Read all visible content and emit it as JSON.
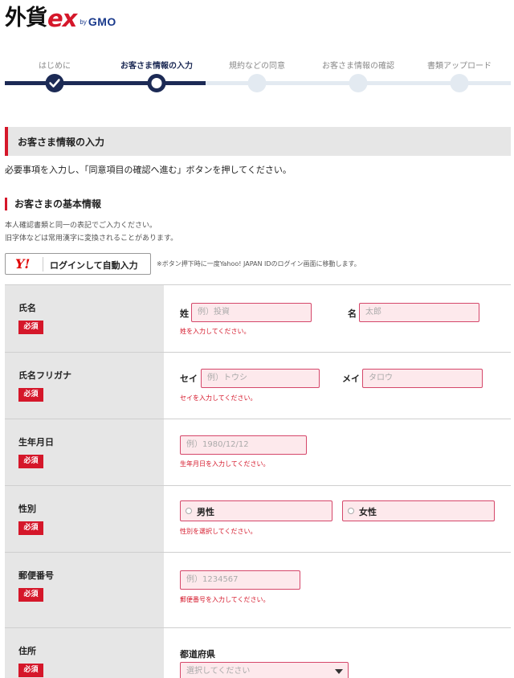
{
  "brand": {
    "main": "外貨",
    "ex": "ex",
    "by": "by",
    "gmo": "GMO"
  },
  "steps": [
    {
      "label": "はじめに",
      "state": "done"
    },
    {
      "label": "お客さま情報の入力",
      "state": "current"
    },
    {
      "label": "規約などの同意",
      "state": "todo"
    },
    {
      "label": "お客さま情報の確認",
      "state": "todo"
    },
    {
      "label": "書類アップロード",
      "state": "todo"
    }
  ],
  "section": {
    "title": "お客さま情報の入力",
    "intro": "必要事項を入力し、「同意項目の確認へ進む」ボタンを押してください。"
  },
  "basic": {
    "title": "お客さまの基本情報",
    "note1": "本人確認書類と同一の表記でご入力ください。",
    "note2": "旧字体などは常用漢字に変換されることがあります。"
  },
  "yahoo": {
    "icon": "Y!",
    "label": "ログインして自動入力",
    "note": "※ボタン押下時に一度Yahoo! JAPAN IDのログイン画面に移動します。"
  },
  "required_label": "必須",
  "form": {
    "name": {
      "label": "氏名",
      "last_prefix": "姓",
      "last_placeholder": "例）投資",
      "first_prefix": "名",
      "first_placeholder": "太郎",
      "error": "姓を入力してください。"
    },
    "kana": {
      "label": "氏名フリガナ",
      "last_prefix": "セイ",
      "last_placeholder": "例）トウシ",
      "first_prefix": "メイ",
      "first_placeholder": "タロウ",
      "error": "セイを入力してください。"
    },
    "birth": {
      "label": "生年月日",
      "placeholder": "例）1980/12/12",
      "error": "生年月日を入力してください。"
    },
    "gender": {
      "label": "性別",
      "option_male": "男性",
      "option_female": "女性",
      "error": "性別を選択してください。"
    },
    "zip": {
      "label": "郵便番号",
      "placeholder": "例）1234567",
      "error": "郵便番号を入力してください。"
    },
    "address": {
      "label": "住所",
      "pref_label": "都道府県",
      "pref_placeholder": "選択してください"
    }
  },
  "colors": {
    "accent": "#d5172a",
    "navy": "#1c2a55",
    "track": "#e3eaf1",
    "input_bg": "#fde9ec"
  }
}
